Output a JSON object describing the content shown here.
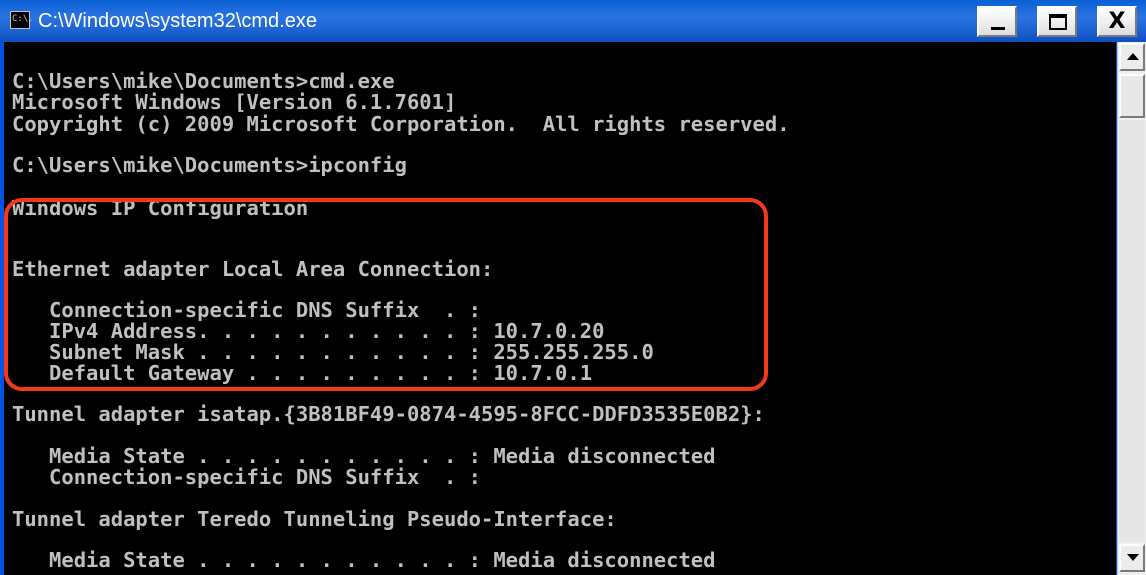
{
  "window": {
    "title": "C:\\Windows\\system32\\cmd.exe",
    "icon_text": "C:\\.",
    "close_glyph": "X"
  },
  "colors": {
    "console_background": "#000000",
    "console_text": "#c0c0c0",
    "title_bar": "#1d64d4",
    "highlight_border": "#f03a1a"
  },
  "icons": {
    "app": "cmd-icon",
    "minimize": "minimize-icon",
    "maximize": "maximize-icon",
    "close": "close-icon",
    "scroll_up": "arrow-up-icon",
    "scroll_down": "arrow-down-icon"
  },
  "console": {
    "lines": [
      "C:\\Users\\mike\\Documents>cmd.exe",
      "Microsoft Windows [Version 6.1.7601]",
      "Copyright (c) 2009 Microsoft Corporation.  All rights reserved.",
      "C:\\Users\\mike\\Documents>ipconfig",
      "Windows IP Configuration",
      "Ethernet adapter Local Area Connection:",
      "   Connection-specific DNS Suffix  . :",
      "   IPv4 Address. . . . . . . . . . . : 10.7.0.20",
      "   Subnet Mask . . . . . . . . . . . : 255.255.255.0",
      "   Default Gateway . . . . . . . . . : 10.7.0.1",
      "Tunnel adapter isatap.{3B81BF49-0874-4595-8FCC-DDFD3535E0B2}:",
      "   Media State . . . . . . . . . . . : Media disconnected",
      "   Connection-specific DNS Suffix  . :",
      "Tunnel adapter Teredo Tunneling Pseudo-Interface:",
      "   Media State . . . . . . . . . . . : Media disconnected"
    ]
  }
}
